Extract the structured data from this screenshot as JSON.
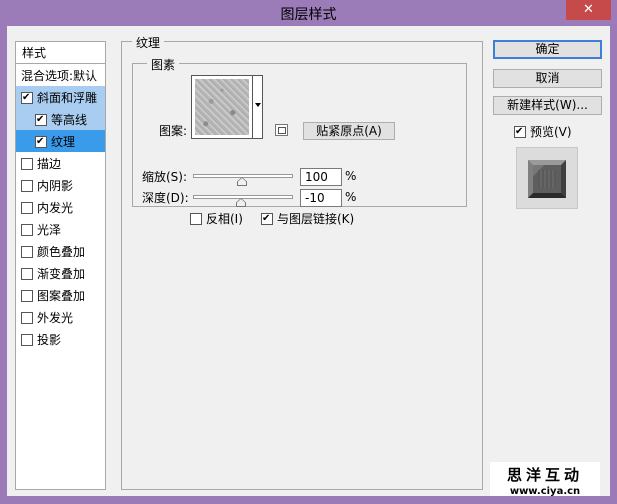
{
  "window": {
    "title": "图层样式",
    "close_glyph": "✕"
  },
  "styles_panel": {
    "header": "样式",
    "blend_options": "混合选项:默认",
    "items": [
      {
        "label": "斜面和浮雕",
        "checked": true
      },
      {
        "label": "等高线",
        "checked": true
      },
      {
        "label": "纹理",
        "checked": true
      },
      {
        "label": "描边",
        "checked": false
      },
      {
        "label": "内阴影",
        "checked": false
      },
      {
        "label": "内发光",
        "checked": false
      },
      {
        "label": "光泽",
        "checked": false
      },
      {
        "label": "颜色叠加",
        "checked": false
      },
      {
        "label": "渐变叠加",
        "checked": false
      },
      {
        "label": "图案叠加",
        "checked": false
      },
      {
        "label": "外发光",
        "checked": false
      },
      {
        "label": "投影",
        "checked": false
      }
    ]
  },
  "texture": {
    "group_title": "纹理",
    "elements_title": "图素",
    "pattern_label": "图案:",
    "snap_origin_button": "贴紧原点(A)",
    "scale_label": "缩放(S):",
    "scale_value": "100",
    "scale_unit": "%",
    "depth_label": "深度(D):",
    "depth_value": "-10",
    "depth_unit": "%",
    "invert_label": "反相(I)",
    "invert_checked": false,
    "link_label": "与图层链接(K)",
    "link_checked": true
  },
  "buttons": {
    "ok": "确定",
    "cancel": "取消",
    "new_style": "新建样式(W)...",
    "preview_label": "预览(V)",
    "preview_checked": true
  },
  "watermark": {
    "title": "思洋互动",
    "url": "www.ciya.cn"
  }
}
